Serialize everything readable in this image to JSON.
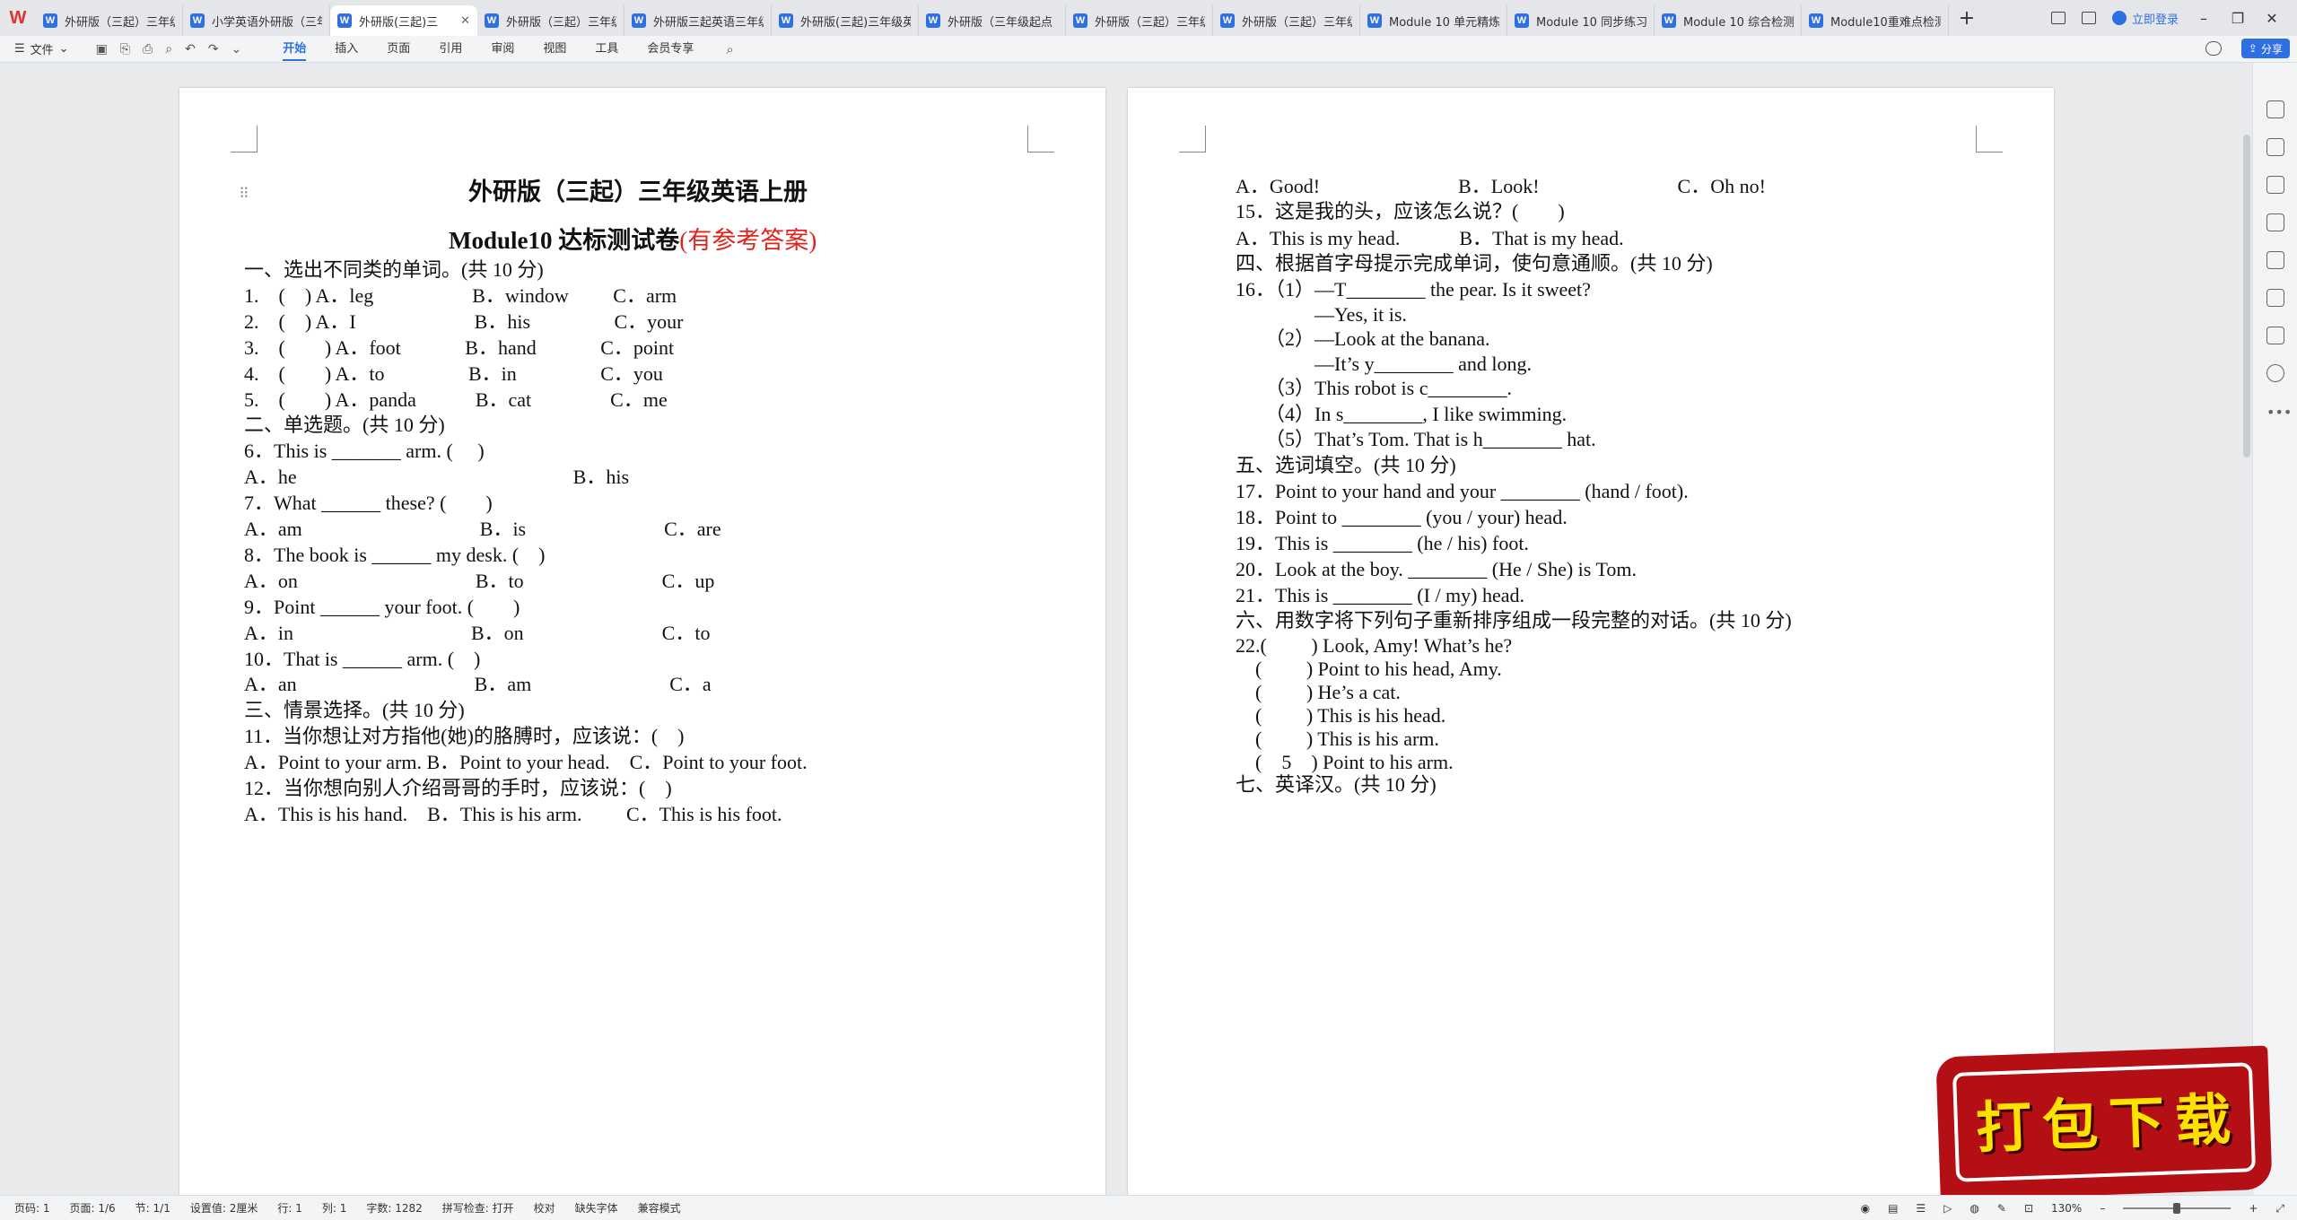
{
  "tabs": [
    {
      "label": "外研版（三起）三年级",
      "active": false
    },
    {
      "label": "小学英语外研版（三年",
      "active": false
    },
    {
      "label": "外研版(三起)三",
      "active": true
    },
    {
      "label": "外研版（三起）三年级",
      "active": false
    },
    {
      "label": "外研版三起英语三年级",
      "active": false
    },
    {
      "label": "外研版(三起)三年级英语",
      "active": false
    },
    {
      "label": "外研版（三年级起点",
      "active": false
    },
    {
      "label": "外研版（三起）三年级",
      "active": false
    },
    {
      "label": "外研版（三起）三年级",
      "active": false
    },
    {
      "label": "Module 10 单元精炼",
      "active": false
    },
    {
      "label": "Module 10 同步练习",
      "active": false
    },
    {
      "label": "Module 10 综合检测",
      "active": false
    },
    {
      "label": "Module10重难点检测",
      "active": false
    }
  ],
  "login_label": "立即登录",
  "menu": {
    "file": "文件",
    "items": [
      "开始",
      "插入",
      "页面",
      "引用",
      "审阅",
      "视图",
      "工具",
      "会员专享"
    ],
    "active": "开始",
    "share": "分享"
  },
  "page1": {
    "title": "外研版（三起）三年级英语上册",
    "subtitle_main": "Module10 达标测试卷",
    "subtitle_red": "(有参考答案)",
    "lines": [
      "一、选出不同类的单词。(共 10 分)",
      "1.　(　) A．leg　　　　　B．window　　 C．arm",
      "2.　(　) A．I　　　　　　B．his　　　　 C．your",
      "3.　(　　) A．foot　　　 B．hand　　　 C．point",
      "4.　(　　) A．to　　　　 B．in　　　　 C．you",
      "5.　(　　) A．panda　　　B．cat　　　　C．me",
      "二、单选题。(共 10 分)",
      "6．This is _______ arm. (　 )",
      "A．he　　　　　　　　　　　　　　B．his",
      "7．What ______ these? (　　)",
      "A．am　　　　　　　　　B．is　　　　　　　C．are",
      "8．The book is ______ my desk. (　)",
      "A．on　　　　　　　　　B．to　　　　　　　C．up",
      "9．Point ______ your foot. (　　)",
      "A．in　　　　　　　　　B．on　　　　　　　C．to",
      "10．That is ______ arm. (　)",
      "A．an　　　　　　　　　B．am　　　　　　　C．a",
      "三、情景选择。(共 10 分)",
      "11．当你想让对方指他(她)的胳膊时，应该说：(　)",
      "A．Point to your arm. B．Point to your head.　C．Point to your foot.",
      "12．当你想向别人介绍哥哥的手时，应该说：(　)",
      "A．This is his hand.　B．This is his arm.　　 C．This is his foot."
    ]
  },
  "page2": {
    "lines": [
      "A．Good!　　　　　　　B．Look!　　　　　　　C．Oh no!",
      "15．这是我的头，应该怎么说？(　　)",
      "A．This is my head.　　　B．That is my head.",
      "四、根据首字母提示完成单词，使句意通顺。(共 10 分)",
      "16．（1）—T________ the pear. Is it sweet?",
      "　　　　—Yes, it is.",
      "　　（2）—Look at the banana.",
      "　　　　—It’s y________ and long.",
      "　　（3）This robot is c________.",
      "　　（4）In s________, I like swimming.",
      "　　（5）That’s Tom. That is h________ hat.",
      "五、选词填空。(共 10 分)",
      "17．Point to your hand and your ________ (hand / foot).",
      "18．Point to ________ (you / your) head.",
      "19．This is ________ (he / his) foot.",
      "20．Look at the boy. ________ (He / She) is Tom.",
      "21．This is ________ (I / my) head.",
      "六、用数字将下列句子重新排序组成一段完整的对话。(共 10 分)",
      "22.(　　 ) Look, Amy! What’s he?",
      "　(　　 ) Point to his head, Amy.",
      "　(　　 ) He’s a cat.",
      "　(　　 ) This is his head.",
      "　(　　 ) This is his arm.",
      "　(　5　) Point to his arm.",
      "七、英译汉。(共 10 分)"
    ]
  },
  "banner_label": "打包下载",
  "status": {
    "items": [
      "页码: 1",
      "页面: 1/6",
      "节: 1/1",
      "设置值: 2厘米",
      "行: 1",
      "列: 1",
      "字数: 1282",
      "拼写检查: 打开",
      "校对",
      "缺失字体",
      "兼容模式"
    ],
    "zoom": "130%"
  },
  "icons": {
    "tab_doc": "w-doc-icon",
    "search": "search-icon",
    "add_tab": "plus-icon"
  }
}
